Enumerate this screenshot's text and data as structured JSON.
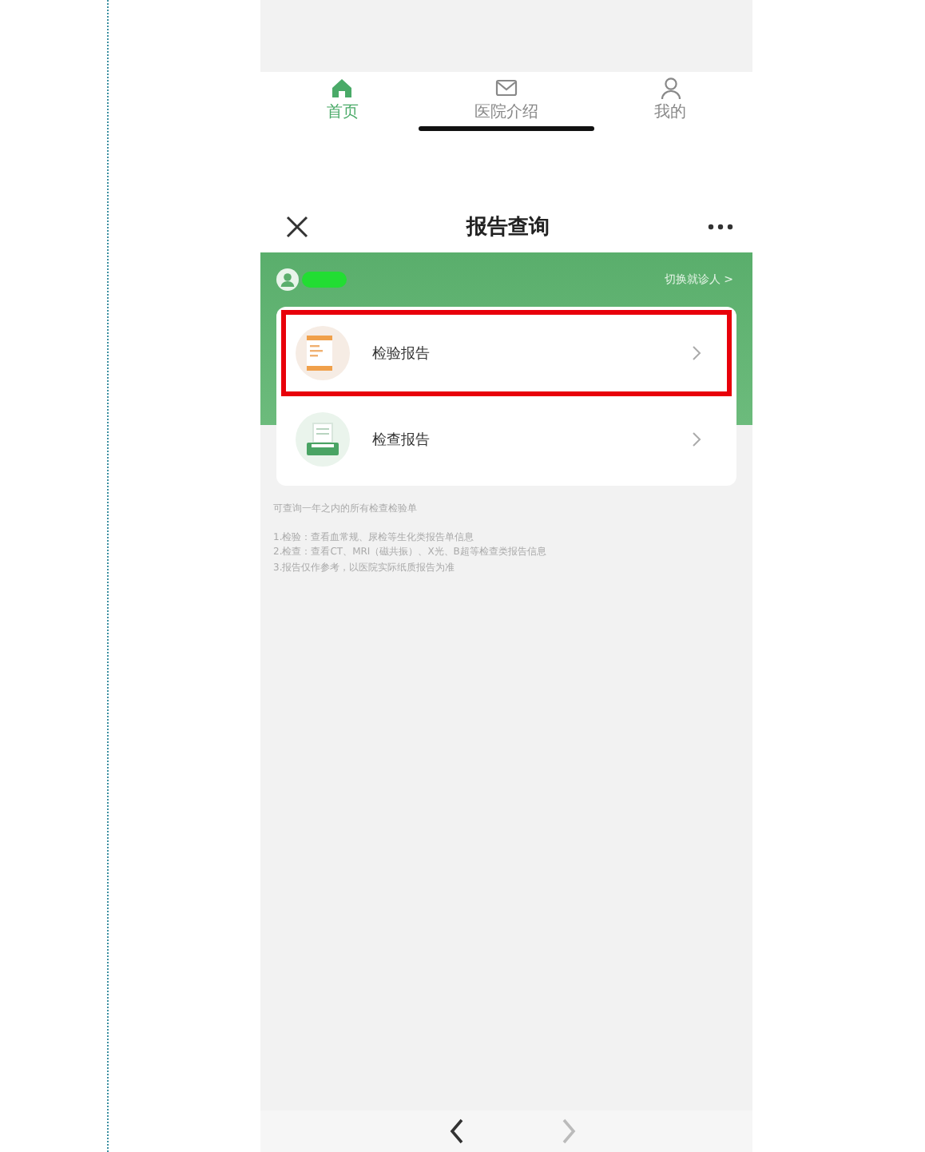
{
  "tab_bar": {
    "tabs": [
      {
        "label": "首页",
        "kind": "home",
        "selected": true
      },
      {
        "label": "医院介绍",
        "kind": "mail",
        "selected": false
      },
      {
        "label": "我的",
        "kind": "person",
        "selected": false
      }
    ]
  },
  "header": {
    "title": "报告查询"
  },
  "patient": {
    "switch_label": "切换就诊人 >"
  },
  "reports": [
    {
      "label": "检验报告",
      "kind": "lab",
      "highlighted": true
    },
    {
      "label": "检查报告",
      "kind": "exam",
      "highlighted": false
    }
  ],
  "notes": [
    "可查询一年之内的所有检查检验单",
    "1.检验：查看血常规、尿检等生化类报告单信息",
    "2.检查：查看CT、MRI（磁共振）、X光、B超等检查类报告信息",
    "3.报告仅作参考，以医院实际纸质报告为准"
  ],
  "nav": {
    "back_disabled": false,
    "forward_disabled": true
  }
}
